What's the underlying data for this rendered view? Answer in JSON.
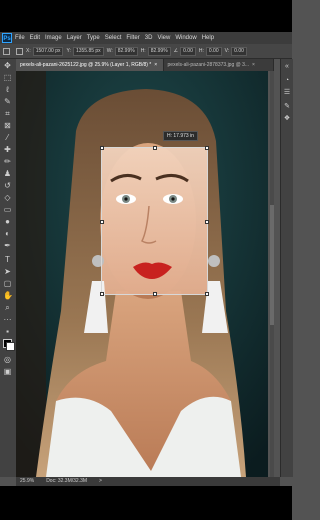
{
  "app": {
    "logo_text": "Ps",
    "menu": [
      "File",
      "Edit",
      "Image",
      "Layer",
      "Type",
      "Select",
      "Filter",
      "3D",
      "View",
      "Window",
      "Help"
    ]
  },
  "options": {
    "x_label": "X:",
    "x_value": "1507.00 px",
    "y_label": "Y:",
    "y_value": "1355.85 px",
    "w_label": "W:",
    "w_value": "82.99%",
    "h_label": "H:",
    "h_value": "82.99%",
    "angle_value": "0.00",
    "h_skew_label": "H:",
    "h_skew_value": "0.00",
    "v_skew_label": "V:",
    "v_skew_value": "0.00"
  },
  "tabs": [
    {
      "label": "pexels-ali-pazani-2625122.jpg @ 25.9% (Layer 1, RGB/8) *",
      "close": "×",
      "active": true
    },
    {
      "label": "pexels-ali-pazani-2878373.jpg @ 3...",
      "close": "×",
      "active": false
    }
  ],
  "canvas": {
    "tooltip": "H: 17.973 in"
  },
  "status": {
    "zoom": "25.9%",
    "doc": "Doc: 32.3M/32.3M",
    "arrow": ">"
  },
  "tools": [
    "move-tool",
    "marquee-tool",
    "lasso-tool",
    "quick-select-tool",
    "crop-tool",
    "frame-tool",
    "eyedropper-tool",
    "healing-brush-tool",
    "brush-tool",
    "clone-stamp-tool",
    "history-brush-tool",
    "eraser-tool",
    "gradient-tool",
    "blur-tool",
    "dodge-tool",
    "pen-tool",
    "type-tool",
    "path-selection-tool",
    "rectangle-tool",
    "hand-tool",
    "zoom-tool",
    "more-tools",
    "color-swatches",
    "quick-mask",
    "screen-mode"
  ]
}
